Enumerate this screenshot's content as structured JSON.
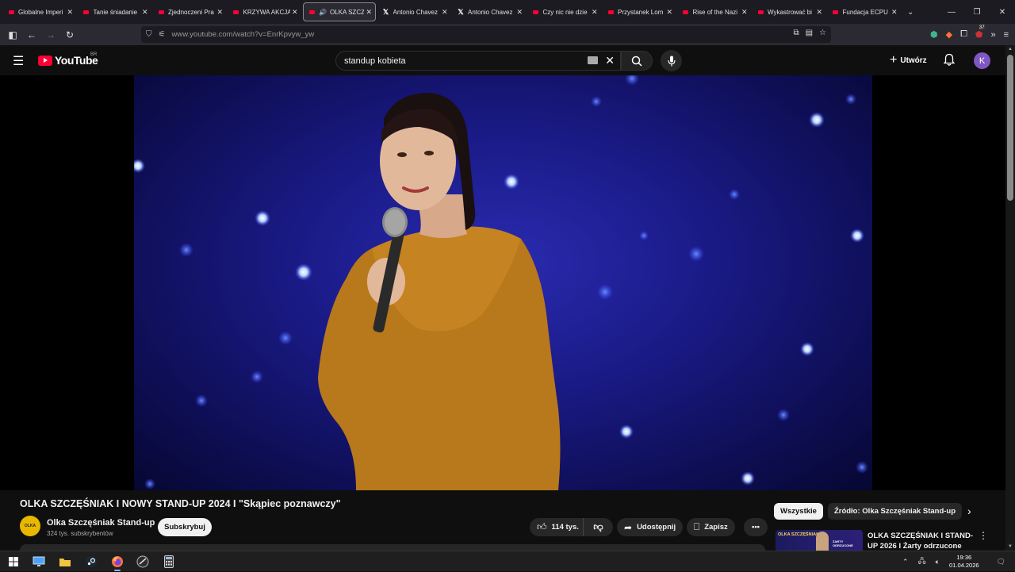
{
  "browser": {
    "tabs": [
      {
        "title": "Globalne Imperi",
        "icon": "youtube-icon",
        "active": false
      },
      {
        "title": "Tanie śniadanie",
        "icon": "youtube-icon",
        "active": false
      },
      {
        "title": "Zjednoczeni Pra",
        "icon": "youtube-icon",
        "active": false
      },
      {
        "title": "KRZYWA AKCJA",
        "icon": "youtube-icon",
        "active": false
      },
      {
        "title": "OLKA SZCZ",
        "icon": "youtube-icon",
        "active": true
      },
      {
        "title": "Antonio Chavez",
        "icon": "x-icon",
        "active": false
      },
      {
        "title": "Antonio Chavez",
        "icon": "x-icon",
        "active": false
      },
      {
        "title": "Czy nic nie dzie",
        "icon": "youtube-icon",
        "active": false
      },
      {
        "title": "Przystanek Lom",
        "icon": "youtube-icon",
        "active": false
      },
      {
        "title": "Rise of the Nazi",
        "icon": "youtube-icon",
        "active": false
      },
      {
        "title": "Wykastrować bi",
        "icon": "youtube-icon",
        "active": false
      },
      {
        "title": "Fundacja ECPU",
        "icon": "youtube-icon",
        "active": false
      }
    ],
    "url_domain": "www.youtube.com",
    "url_path": "/watch?v=EnrKpvyw_yw",
    "extension_badge": "37"
  },
  "youtube": {
    "logo_text": "YouTube",
    "country_code": "BR",
    "search_value": "standup kobieta",
    "create_label": "Utwórz",
    "avatar_letter": "K"
  },
  "video": {
    "title": "OLKA SZCZĘŚNIAK I NOWY STAND-UP 2024 I \"Skąpiec poznawczy\"",
    "channel_name": "Olka Szczęśniak Stand-up",
    "channel_avatar_text": "OLKA",
    "subscribers": "324 tys. subskrybentów",
    "subscribe_label": "Subskrybuj",
    "likes": "114 tys.",
    "share_label": "Udostępnij",
    "save_label": "Zapisz"
  },
  "sidebar": {
    "chips": [
      "Wszystkie",
      "Źródło: Olka Szczęśniak Stand-up"
    ],
    "recommended": {
      "title": "OLKA SZCZĘŚNIAK I STAND-UP 2026 I Żarty odrzucone",
      "thumb_text": "OLKA SZCZĘŚNIAK",
      "thumb_text2": "ŻARTY ODRZUCONE"
    }
  },
  "taskbar": {
    "time": "19:36",
    "date": "01.04.2026"
  },
  "colors": {
    "youtube_red": "#ff0033",
    "avatar_purple": "#7e57c2",
    "background": "#0f0f0f"
  }
}
